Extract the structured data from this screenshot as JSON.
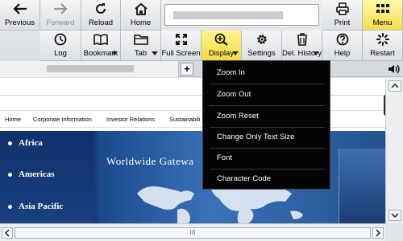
{
  "toolbar": {
    "row1": {
      "previous": "Previous",
      "forward": "Forward",
      "reload": "Reload",
      "home": "Home",
      "print": "Print",
      "menu": "Menu"
    },
    "row2": {
      "log": "Log",
      "bookmark": "Bookmark",
      "tab": "Tab",
      "full_screen": "Full Screen",
      "display": "Display",
      "settings": "Settings",
      "del_history": "Del. History",
      "help": "Help",
      "restart": "Restart"
    }
  },
  "tab_bar": {
    "new_tab": "+"
  },
  "display_menu": {
    "items": [
      "Zoom In",
      "Zoom Out",
      "Zoom Reset",
      "Change Only Text Size",
      "Font",
      "Character Code"
    ]
  },
  "webpage": {
    "nav": [
      "Home",
      "Corporate Information",
      "Investor Relations",
      "Sustainabili"
    ],
    "regions": [
      "Africa",
      "Americas",
      "Asia Pacific"
    ],
    "hero_title": "Worldwide Gatewa"
  },
  "scrollbar": {
    "thumb_grip": "III"
  },
  "colors": {
    "active_button": "#f2d94a",
    "menu_background": "#050505",
    "hero_blue": "#1a4a8c"
  }
}
